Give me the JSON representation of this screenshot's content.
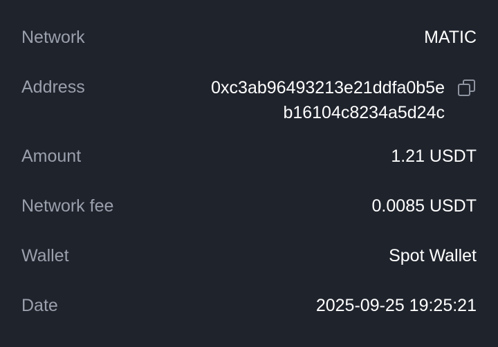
{
  "rows": {
    "network": {
      "label": "Network",
      "value": "MATIC"
    },
    "address": {
      "label": "Address",
      "line1": "0xc3ab96493213e21ddfa0b5e",
      "line2": "b16104c8234a5d24c",
      "copy_icon": "copy-icon"
    },
    "amount": {
      "label": "Amount",
      "value": "1.21 USDT"
    },
    "network_fee": {
      "label": "Network fee",
      "value": "0.0085 USDT"
    },
    "wallet": {
      "label": "Wallet",
      "value": "Spot Wallet"
    },
    "date": {
      "label": "Date",
      "value": "2025-09-25 19:25:21"
    }
  },
  "colors": {
    "background": "#1f232c",
    "label": "#9aa0ac",
    "value": "#ffffff"
  }
}
